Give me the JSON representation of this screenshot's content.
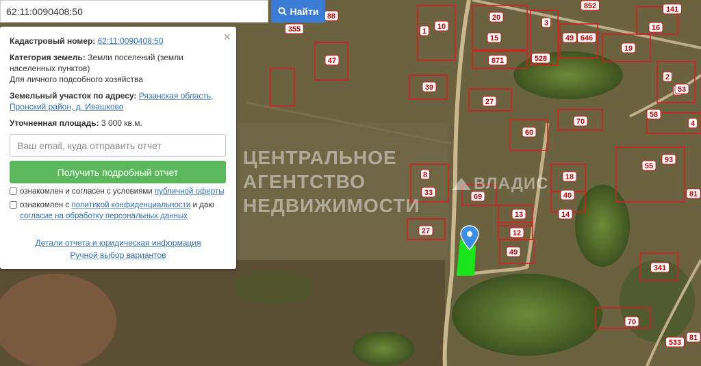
{
  "search": {
    "value": "62:11:0090408:50",
    "button_label": "Найти"
  },
  "info_panel": {
    "close_symbol": "×",
    "cadastral_label": "Кадастровый номер:",
    "cadastral_number": "62:11:0090408:50",
    "category_label": "Категория земель:",
    "category_value": "Земли поселений (земли населенных пунктов)",
    "usage": "Для личного подсобного хозяйства",
    "address_label": "Земельный участок по адресу:",
    "address_value": "Рязанская область, Пронский район, д. Ивашково",
    "area_label": "Уточненная площадь:",
    "area_value": "3 000 кв.м.",
    "email_placeholder": "Ваш email, куда отправить отчет",
    "report_button": "Получить подробный отчет",
    "consent1_prefix": "ознакомлен и согласен с условиями",
    "consent1_link": "публичной оферты",
    "consent2_prefix": "ознакомлен с",
    "consent2_link1": "политикой конфиденциальности",
    "consent2_mid": "и даю",
    "consent2_link2": "согласие на обработку персональных данных",
    "details_link": "Детали отчета и юридическая информация",
    "manual_link": "Ручной выбор вариантов"
  },
  "watermarks": {
    "line1": "ЦЕНТРАЛЬНОЕ",
    "line2": "АГЕНТСТВО",
    "line3": "НЕДВИЖИМОСТИ",
    "brand": "ВЛАДИС"
  },
  "map_labels": [
    "88",
    "355",
    "1",
    "10",
    "20",
    "3",
    "852",
    "141",
    "16",
    "15",
    "49",
    "646",
    "19",
    "47",
    "871",
    "528",
    "2",
    "3",
    "39",
    "27",
    "58",
    "4",
    "70",
    "60",
    "53",
    "55",
    "93",
    "8",
    "18",
    "33",
    "69",
    "40",
    "81",
    "14",
    "13",
    "27",
    "12",
    "49",
    "341",
    "70",
    "81",
    "533"
  ],
  "colors": {
    "parcel_border": "#d42020",
    "selected_parcel": "#19e619",
    "pin": "#3a8ee6",
    "search_button": "#3a7bd5",
    "report_button": "#5cb85c"
  }
}
